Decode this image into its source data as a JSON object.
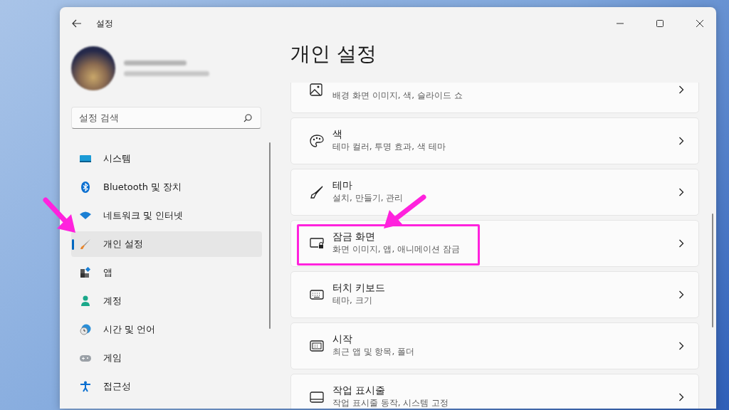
{
  "window": {
    "title": "설정"
  },
  "search": {
    "placeholder": "설정 검색"
  },
  "arrow_to_selected_nav": true,
  "nav_items": [
    {
      "label": "시스템",
      "selected": false
    },
    {
      "label": "Bluetooth 및 장치",
      "selected": false
    },
    {
      "label": "네트워크 및 인터넷",
      "selected": false
    },
    {
      "label": "개인 설정",
      "selected": true
    },
    {
      "label": "앱",
      "selected": false
    },
    {
      "label": "계정",
      "selected": false
    },
    {
      "label": "시간 및 언어",
      "selected": false
    },
    {
      "label": "게임",
      "selected": false
    },
    {
      "label": "접근성",
      "selected": false
    }
  ],
  "page_title": "개인 설정",
  "cards": [
    {
      "description": "배경 화면 이미지, 색, 슬라이드 쇼",
      "marked": false
    },
    {
      "title": "색",
      "description": "테마 컬러, 투명 효과, 색 테마",
      "marked": false
    },
    {
      "title": "테마",
      "description": "설치, 만들기, 관리",
      "marked": false
    },
    {
      "title": "잠금 화면",
      "description": "화면 이미지, 앱, 애니메이션 잠금",
      "marked": true
    },
    {
      "title": "터치 키보드",
      "description": "테마, 크기",
      "marked": false
    },
    {
      "title": "시작",
      "description": "최근 앱 및 항목, 폴더",
      "marked": false
    },
    {
      "title": "작업 표시줄",
      "description": "작업 표시줄 동작, 시스템 고정",
      "marked": false
    }
  ]
}
